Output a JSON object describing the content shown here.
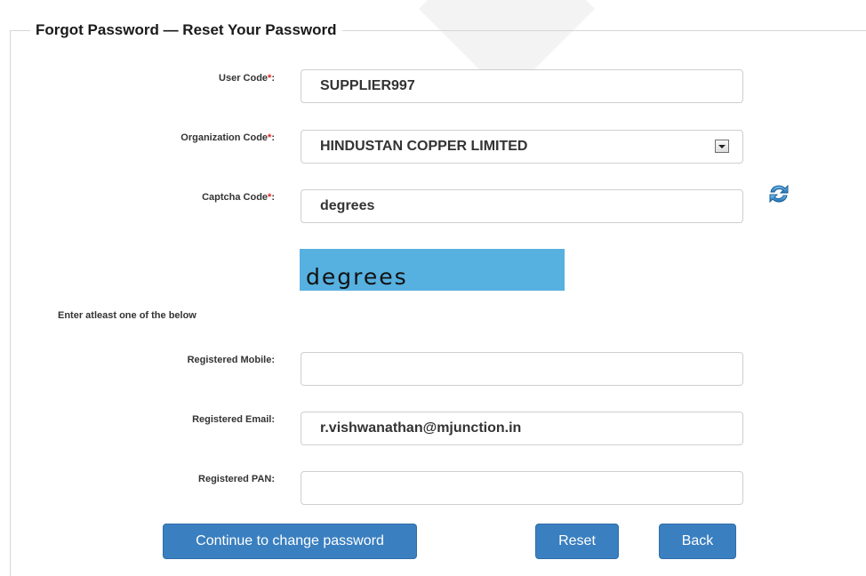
{
  "form": {
    "title": "Forgot Password — Reset Your Password",
    "required_mark": "*",
    "colon": ":",
    "user_code": {
      "label": "User Code",
      "value": "SUPPLIER997"
    },
    "organization_code": {
      "label": "Organization Code",
      "value": "HINDUSTAN COPPER LIMITED"
    },
    "captcha_code": {
      "label": "Captcha Code",
      "value": "degrees",
      "image_text": "degrees",
      "refresh_icon": "refresh-icon"
    },
    "note": "Enter atleast one of the below",
    "registered_mobile": {
      "label": "Registered Mobile:",
      "value": ""
    },
    "registered_email": {
      "label": "Registered Email:",
      "value": "r.vishwanathan@mjunction.in"
    },
    "registered_pan": {
      "label": "Registered PAN:",
      "value": ""
    }
  },
  "buttons": {
    "continue": "Continue to change password",
    "reset": "Reset",
    "back": "Back"
  },
  "colors": {
    "primary_button": "#3a7fc0",
    "captcha_bg": "#56b0e0",
    "required": "#e0231d"
  }
}
